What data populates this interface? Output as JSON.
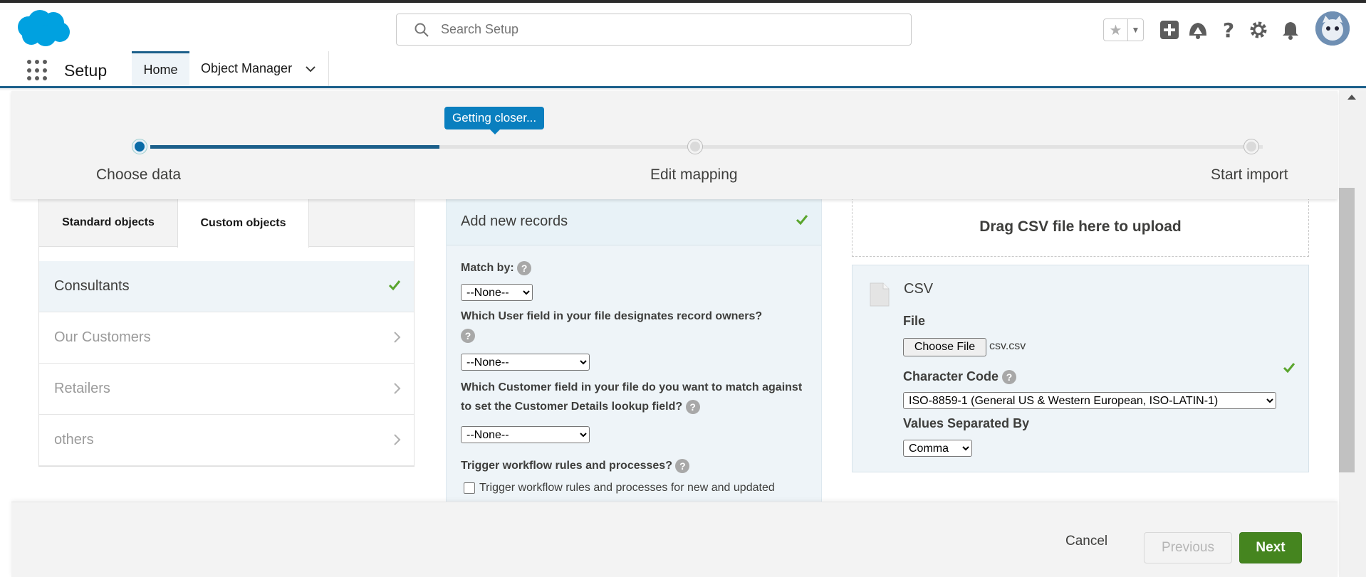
{
  "header": {
    "search_placeholder": "Search Setup",
    "icons": [
      "star-icon",
      "add-icon",
      "trailhead-icon",
      "help-icon",
      "gear-icon",
      "bell-icon"
    ]
  },
  "nav": {
    "app_name": "Setup",
    "tabs": [
      {
        "label": "Home",
        "active": true
      },
      {
        "label": "Object Manager",
        "active": false
      }
    ]
  },
  "progress": {
    "tooltip": "Getting closer...",
    "steps": [
      "Choose data",
      "Edit mapping",
      "Start import"
    ],
    "completion": 0.26
  },
  "objects": {
    "tabs": [
      "Standard objects",
      "Custom objects"
    ],
    "items": [
      {
        "label": "Consultants",
        "selected": true
      },
      {
        "label": "Our Customers",
        "selected": false
      },
      {
        "label": "Retailers",
        "selected": false
      },
      {
        "label": "others",
        "selected": false
      }
    ]
  },
  "action": {
    "heading": "Add new records",
    "match_by_label": "Match by:",
    "match_by_value": "--None--",
    "owner_question": "Which User field in your file designates record owners?",
    "owner_value": "--None--",
    "customer_question": "Which Customer field in your file do you want to match against to set the Customer Details lookup field?",
    "customer_value": "--None--",
    "workflow_label": "Trigger workflow rules and processes?",
    "workflow_checkbox_label": "Trigger workflow rules and processes for new and updated"
  },
  "upload": {
    "dropzone_text": "Drag CSV file here to upload",
    "source_title": "CSV",
    "file_label": "File",
    "choose_file_label": "Choose File",
    "file_name": "csv.csv",
    "char_code_label": "Character Code",
    "char_code_value": "ISO-8859-1 (General US & Western European, ISO-LATIN-1)",
    "separator_label": "Values Separated By",
    "separator_value": "Comma"
  },
  "footer": {
    "cancel": "Cancel",
    "previous": "Previous",
    "next": "Next"
  },
  "colors": {
    "brand": "#1b5f8a",
    "success": "#4bca81",
    "next_button": "#45851f"
  }
}
